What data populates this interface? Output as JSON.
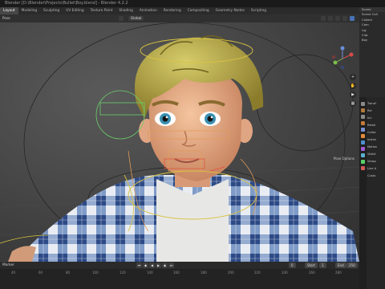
{
  "window": {
    "title": "Blender [D:\\Blender\\Projects\\Bullet\\Boy.blend] - Blender 4.2.2"
  },
  "workspaces": [
    "Layout",
    "Modeling",
    "Sculpting",
    "UV Editing",
    "Texture Paint",
    "Shading",
    "Animation",
    "Rendering",
    "Compositing",
    "Geometry Nodes",
    "Scripting"
  ],
  "viewport": {
    "mode": "Pose",
    "pivot": "Global",
    "pose_options": "Pose Options",
    "nav_tools": [
      "+",
      "✋",
      "▶",
      "▦"
    ]
  },
  "outliner": {
    "title": "Scene",
    "rows": [
      "Scene Coll",
      "Collect",
      "Cam",
      "Lig",
      "Cub",
      "Boy"
    ]
  },
  "properties": {
    "sections": [
      "Transf",
      "Rel",
      "Inv",
      "Relati",
      "Collec",
      "Instan",
      "Motion",
      "Visibil",
      "Viewp",
      "Line A",
      "Custo"
    ]
  },
  "timeline": {
    "label": "Marker",
    "current_frame": "0",
    "start_label": "Start",
    "start_value": "1",
    "end_label": "End",
    "end_value": "250",
    "ruler": [
      "40",
      "60",
      "80",
      "100",
      "120",
      "140",
      "160",
      "180",
      "200",
      "220",
      "240",
      "260",
      "280"
    ]
  },
  "colors": {
    "accent": "#4772b3",
    "bg_panel": "#303030"
  }
}
